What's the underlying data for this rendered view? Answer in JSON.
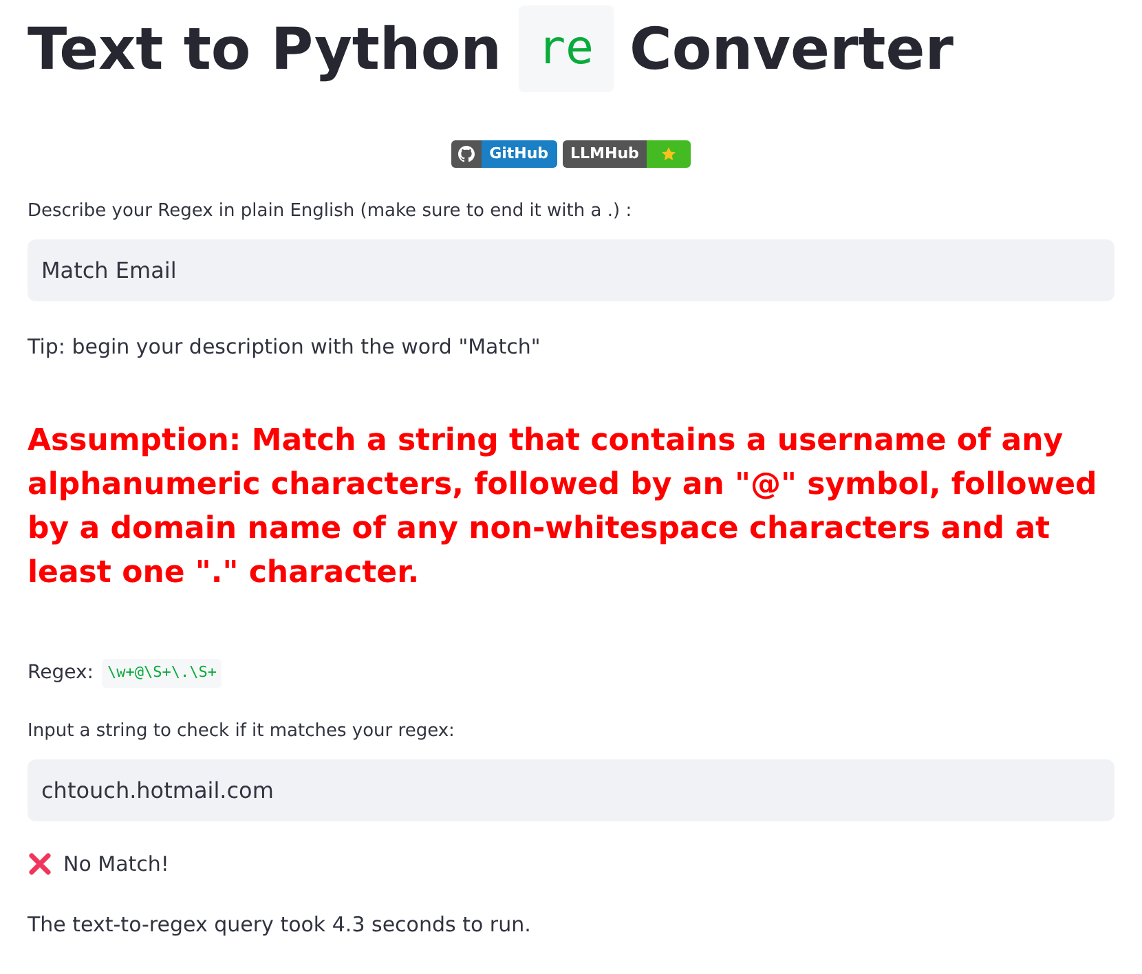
{
  "title": {
    "before": "Text to Python",
    "code": "re",
    "after": "Converter"
  },
  "badges": [
    {
      "kind": "github",
      "label": "GitHub"
    },
    {
      "kind": "llmhub",
      "label": "LLMHub"
    }
  ],
  "description_field": {
    "label": "Describe your Regex in plain English (make sure to end it with a .) :",
    "value": "Match Email"
  },
  "tip": "Tip: begin your description with the word \"Match\"",
  "assumption": "Assumption: Match a string that contains a username of any alphanumeric characters, followed by an \"@\" symbol, followed by a domain name of any non-whitespace characters and at least one \".\" character.",
  "regex": {
    "label": "Regex:",
    "code": "\\w+@\\S+\\.\\S+"
  },
  "test_field": {
    "label": "Input a string to check if it matches your regex:",
    "value": "chtouch.hotmail.com"
  },
  "result": {
    "matched": false,
    "text": "No Match!"
  },
  "timing": "The text-to-regex query took 4.3 seconds to run."
}
